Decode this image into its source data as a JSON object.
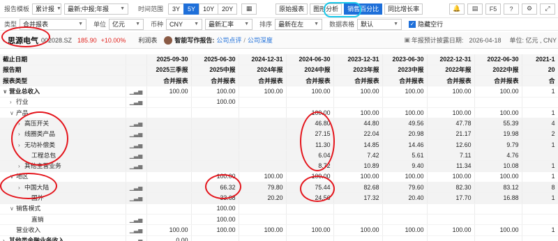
{
  "toolbar": {
    "report_template_label": "报告模板",
    "report_template_value": "累计报",
    "period_select": "最新;中报;年报",
    "time_range_label": "时间范围",
    "ranges": [
      "3Y",
      "5Y",
      "10Y",
      "20Y"
    ],
    "active_range": "5Y",
    "calendar_icon": "calendar-icon",
    "buttons": [
      "原始报表",
      "图形分析",
      "销售百分比",
      "同比增长率"
    ],
    "active_button": "销售百分比",
    "right_icons": [
      "bell-icon",
      "table-icon",
      "F5",
      "help-icon",
      "settings-icon",
      "expand-icon"
    ]
  },
  "filters": {
    "type_label": "类型",
    "type_value": "合并报表",
    "unit_label": "单位",
    "unit_value": "亿元",
    "currency_label": "币种",
    "currency_value": "CNY",
    "rate_value": "最新汇率",
    "sort_label": "排序",
    "sort_value": "最新在左",
    "format_label": "数据表格",
    "format_value": "默认",
    "hide_empty_label": "隐藏空行",
    "hide_empty_checked": true
  },
  "stock": {
    "name": "思源电气",
    "code": "002028.SZ",
    "price": "185.90",
    "change": "+10.00%",
    "tab": "利润表",
    "ai_label": "智能写作报告:",
    "ai_link1": "公司点评",
    "ai_sep": "/",
    "ai_link2": "公司深度",
    "forecast_label": "年报预计披露日期:",
    "forecast_date": "2026-04-18",
    "unit_note": "单位: 亿元 , CNY"
  },
  "table": {
    "head": [
      [
        "截止日期",
        "2025-09-30",
        "2025-06-30",
        "2024-12-31",
        "2024-06-30",
        "2023-12-31",
        "2023-06-30",
        "2022-12-31",
        "2022-06-30",
        "2021-1"
      ],
      [
        "报告期",
        "2025三季报",
        "2025中报",
        "2024年报",
        "2024中报",
        "2023年报",
        "2023中报",
        "2022年报",
        "2022中报",
        "20"
      ],
      [
        "报表类型",
        "合并报表",
        "合并报表",
        "合并报表",
        "合并报表",
        "合并报表",
        "合并报表",
        "合并报表",
        "合并报表",
        "合"
      ]
    ],
    "rows": [
      {
        "name": "营业总收入",
        "tw": "v",
        "lvl": 0,
        "bold": true,
        "chart": true,
        "v": [
          "100.00",
          "100.00",
          "100.00",
          "100.00",
          "100.00",
          "100.00",
          "100.00",
          "100.00",
          "1"
        ]
      },
      {
        "name": "行业",
        "tw": ">",
        "lvl": 1,
        "chart": true,
        "v": [
          "",
          "100.00",
          "",
          "",
          "",
          "",
          "",
          "",
          ""
        ]
      },
      {
        "name": "产品",
        "tw": "v",
        "lvl": 1,
        "chart": false,
        "v": [
          "",
          "",
          "",
          "100.00",
          "100.00",
          "100.00",
          "100.00",
          "100.00",
          "1"
        ]
      },
      {
        "name": "高压开关",
        "tw": ">",
        "lvl": 2,
        "alt": true,
        "chart": true,
        "v": [
          "",
          "",
          "",
          "46.80",
          "44.80",
          "49.56",
          "47.78",
          "55.39",
          "4"
        ]
      },
      {
        "name": "线圈类产品",
        "tw": ">",
        "lvl": 2,
        "alt": true,
        "chart": true,
        "v": [
          "",
          "",
          "",
          "27.15",
          "22.04",
          "20.98",
          "21.17",
          "19.98",
          "2"
        ]
      },
      {
        "name": "无功补偿类",
        "tw": ">",
        "lvl": 2,
        "alt": true,
        "chart": true,
        "v": [
          "",
          "",
          "",
          "11.30",
          "14.85",
          "14.46",
          "12.60",
          "9.79",
          "1"
        ]
      },
      {
        "name": "工程总包",
        "tw": "",
        "lvl": 3,
        "alt": true,
        "chart": true,
        "v": [
          "",
          "",
          "",
          "6.04",
          "7.42",
          "5.61",
          "7.11",
          "4.76",
          ""
        ]
      },
      {
        "name": "其他主营业务",
        "tw": ">",
        "lvl": 2,
        "alt": true,
        "chart": true,
        "v": [
          "",
          "",
          "",
          "8.72",
          "10.89",
          "9.40",
          "11.34",
          "10.08",
          "1"
        ]
      },
      {
        "name": "地区",
        "tw": "v",
        "lvl": 1,
        "chart": false,
        "v": [
          "",
          "100.00",
          "100.00",
          "100.00",
          "100.00",
          "100.00",
          "100.00",
          "100.00",
          "1"
        ]
      },
      {
        "name": "中国大陆",
        "tw": ">",
        "lvl": 2,
        "alt": true,
        "chart": true,
        "v": [
          "",
          "66.32",
          "79.80",
          "75.44",
          "82.68",
          "79.60",
          "82.30",
          "83.12",
          "8"
        ]
      },
      {
        "name": "国外",
        "tw": "",
        "lvl": 3,
        "alt": true,
        "chart": true,
        "v": [
          "",
          "33.68",
          "20.20",
          "24.56",
          "17.32",
          "20.40",
          "17.70",
          "16.88",
          "1"
        ]
      },
      {
        "name": "销售模式",
        "tw": "v",
        "lvl": 1,
        "chart": false,
        "v": [
          "",
          "100.00",
          "",
          "",
          "",
          "",
          "",
          "",
          ""
        ]
      },
      {
        "name": "直销",
        "tw": "",
        "lvl": 3,
        "chart": true,
        "v": [
          "",
          "100.00",
          "",
          "",
          "",
          "",
          "",
          "",
          ""
        ]
      },
      {
        "name": "营业收入",
        "tw": "",
        "lvl": 1,
        "chart": true,
        "v": [
          "100.00",
          "100.00",
          "100.00",
          "100.00",
          "100.00",
          "100.00",
          "100.00",
          "100.00",
          "1"
        ]
      },
      {
        "name": "其他类金融业务收入",
        "tw": ">",
        "lvl": 0,
        "bold": true,
        "chart": true,
        "v": [
          "0.00",
          "",
          "",
          "",
          "",
          "",
          "",
          "",
          ""
        ]
      }
    ]
  }
}
